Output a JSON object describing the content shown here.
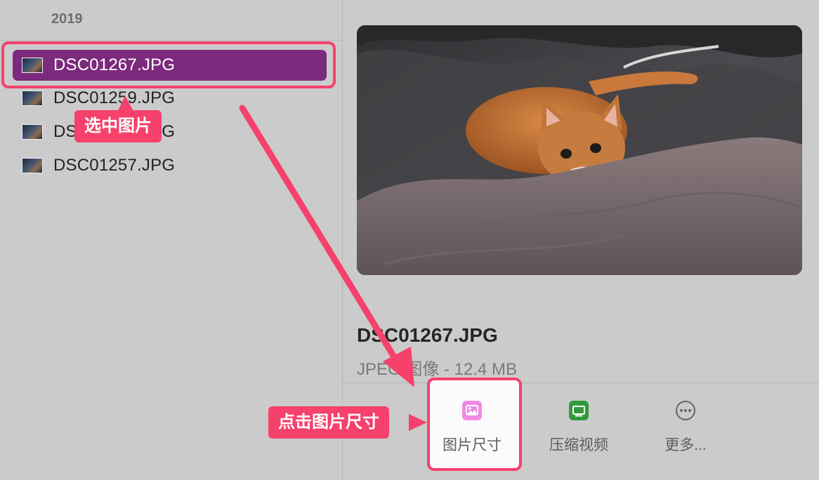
{
  "sidebar": {
    "year_header": "2019",
    "files": [
      {
        "name": "DSC01267.JPG",
        "selected": true
      },
      {
        "name": "DSC01259.JPG",
        "selected": false
      },
      {
        "name": "DSC01258.JPG",
        "selected": false
      },
      {
        "name": "DSC01257.JPG",
        "selected": false
      }
    ]
  },
  "preview": {
    "file_name": "DSC01267.JPG",
    "file_info": "JPEG 图像 - 12.4 MB"
  },
  "actions": [
    {
      "label": "图片尺寸",
      "icon": "image-icon",
      "color": "#e478d6"
    },
    {
      "label": "压缩视频",
      "icon": "video-compress-icon",
      "color": "#2f9a3a"
    },
    {
      "label": "更多...",
      "icon": "more-icon",
      "color": "#666666"
    }
  ],
  "annotations": {
    "select_label": "选中图片",
    "size_label": "点击图片尺寸",
    "accent_color": "#f5416c"
  }
}
